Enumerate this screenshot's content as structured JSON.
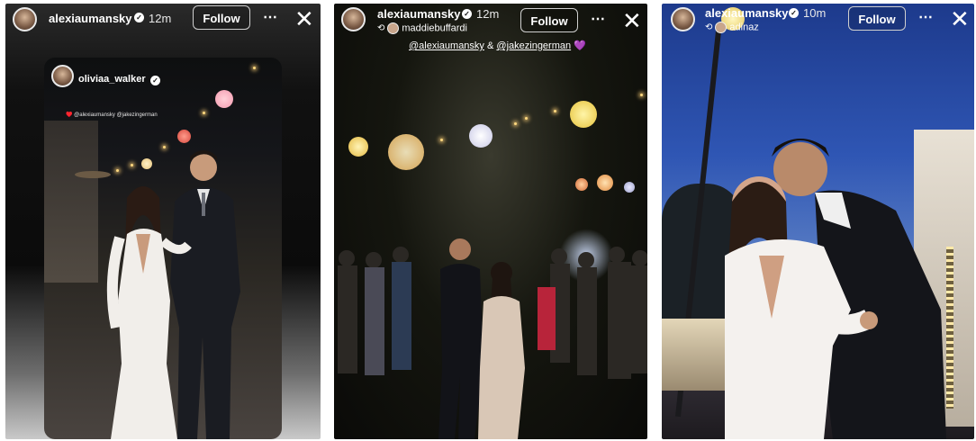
{
  "stories": [
    {
      "username": "alexiaumansky",
      "time": "12m",
      "follow_label": "Follow",
      "more_icon": "⋯",
      "close_icon": "✕",
      "card": {
        "username": "oliviaa_walker",
        "tags": "♥️ @alexiaumansky @jakezingerman"
      }
    },
    {
      "username": "alexiaumansky",
      "time": "12m",
      "follow_label": "Follow",
      "more_icon": "⋯",
      "close_icon": "✕",
      "repost_from": "maddiebuffardi",
      "tag_line": {
        "user1": "@alexiaumansky",
        "amp": "&",
        "user2": "@jakezingerman",
        "heart": "💜"
      }
    },
    {
      "username": "alexiaumansky",
      "time": "10m",
      "follow_label": "Follow",
      "more_icon": "⋯",
      "close_icon": "✕",
      "repost_from": "adinaz"
    }
  ]
}
